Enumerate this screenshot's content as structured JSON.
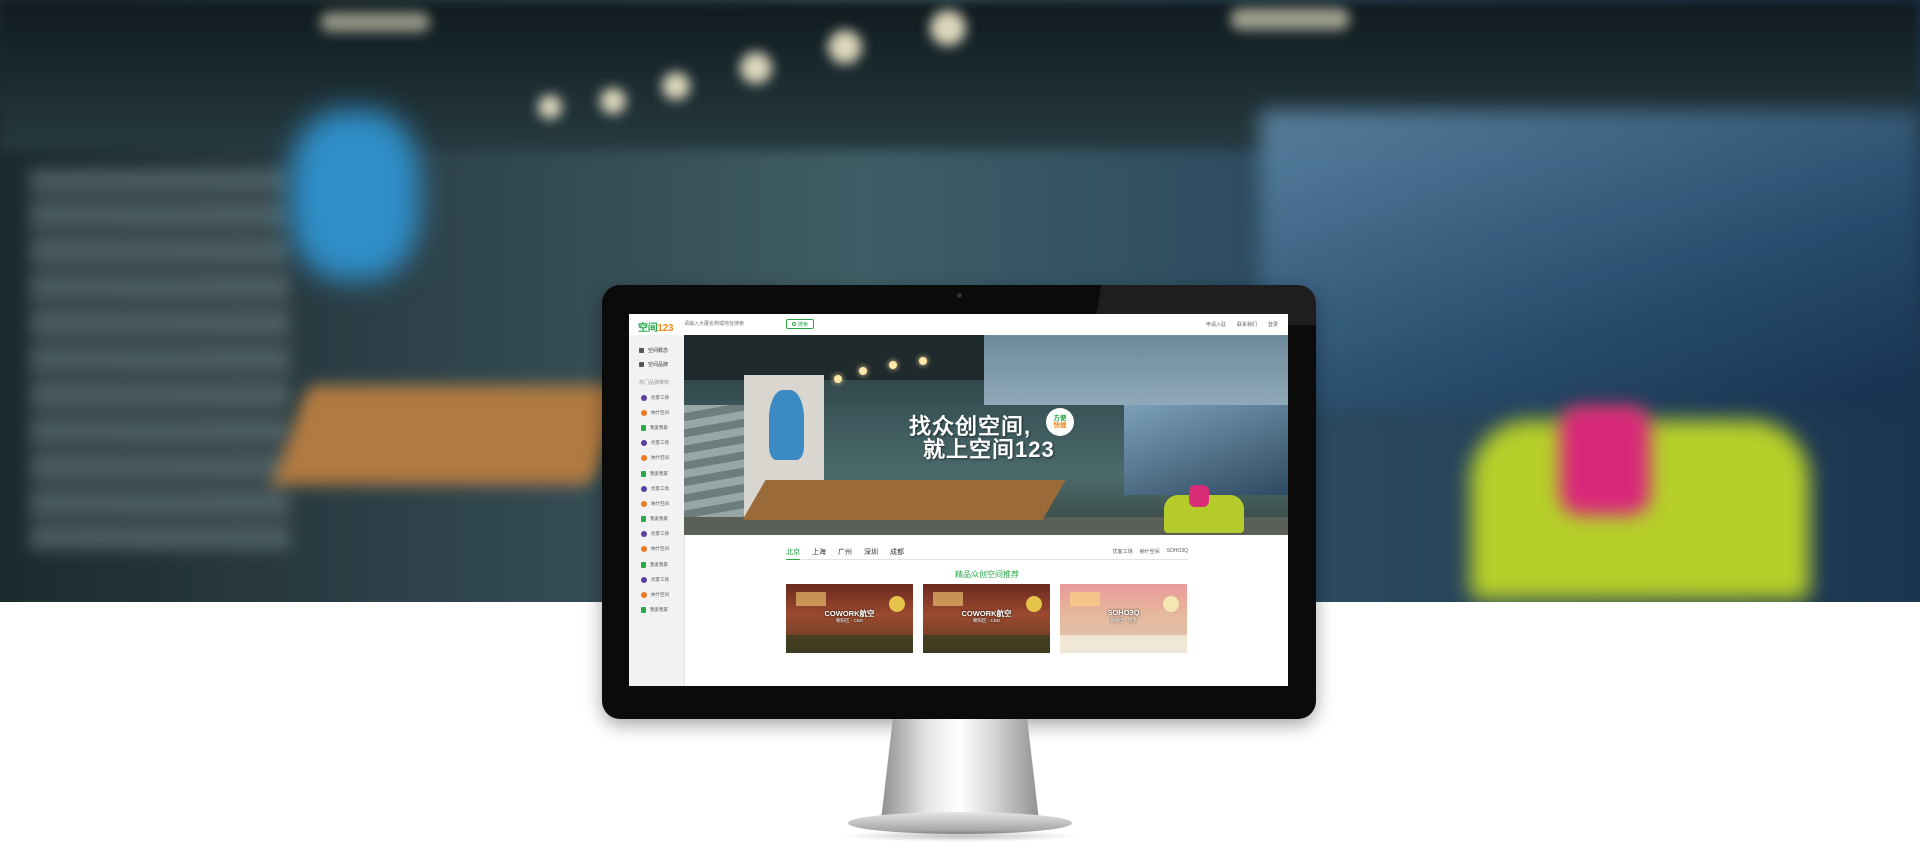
{
  "site": {
    "logo_text": "空间",
    "logo_num": "123",
    "search_placeholder": "请输入大厦名称或地址搜索",
    "search_button": "搜索",
    "top_links": [
      "申请入驻",
      "联系我们",
      "登录"
    ]
  },
  "sidebar": {
    "menu": [
      {
        "label": "空间概念",
        "icon": "pencil-icon"
      },
      {
        "label": "空间品牌",
        "icon": "crown-icon"
      }
    ],
    "caption": "热门品牌推荐",
    "brands": [
      {
        "label": "优客工场",
        "icon": "v"
      },
      {
        "label": "纳什空间",
        "icon": "n"
      },
      {
        "label": "我爱我家",
        "icon": "g"
      },
      {
        "label": "优客工场",
        "icon": "v"
      },
      {
        "label": "纳什空间",
        "icon": "n"
      },
      {
        "label": "我爱我家",
        "icon": "g"
      },
      {
        "label": "优客工场",
        "icon": "v"
      },
      {
        "label": "纳什空间",
        "icon": "n"
      },
      {
        "label": "我爱我家",
        "icon": "g"
      },
      {
        "label": "优客工场",
        "icon": "v"
      },
      {
        "label": "纳什空间",
        "icon": "n"
      },
      {
        "label": "我爱我家",
        "icon": "g"
      },
      {
        "label": "优客工场",
        "icon": "v"
      },
      {
        "label": "纳什空间",
        "icon": "n"
      },
      {
        "label": "我爱我家",
        "icon": "g"
      }
    ]
  },
  "banner": {
    "line1": "找众创空间,",
    "line2": "就上空间123",
    "badge_top": "方便",
    "badge_bottom": "快捷"
  },
  "cities": {
    "tabs": [
      "北京",
      "上海",
      "广州",
      "深圳",
      "成都"
    ],
    "active": "北京",
    "links": [
      "优客工场",
      "纳什空间",
      "SOHO3Q"
    ]
  },
  "section_title": "精品众创空间推荐",
  "cards": [
    {
      "name": "COWORK航空",
      "sub": "朝阳区 · CBD"
    },
    {
      "name": "COWORK航空",
      "sub": "朝阳区 · CBD"
    },
    {
      "name": "SOHO3Q",
      "sub": "朝阳区 · 望京"
    }
  ]
}
